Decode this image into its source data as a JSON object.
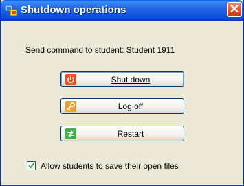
{
  "window": {
    "title": "Shutdown operations",
    "close_glyph": "✕"
  },
  "dialog": {
    "send_label": "Send command to student: Student 1911"
  },
  "buttons": [
    {
      "label": "Shut down",
      "icon": "power-icon",
      "focused": true
    },
    {
      "label": "Log off",
      "icon": "logoff-key-icon"
    },
    {
      "label": "Restart",
      "icon": "restart-arrows-icon"
    }
  ],
  "option": {
    "label": "Allow students to save their open files",
    "checked": true
  },
  "colors": {
    "titlebar": "#2467e6",
    "window_bg": "#ece9d8",
    "close_button": "#e2552b",
    "power_icon": "#e8501f",
    "logoff_icon": "#f0a030",
    "restart_icon": "#3bb54a"
  }
}
